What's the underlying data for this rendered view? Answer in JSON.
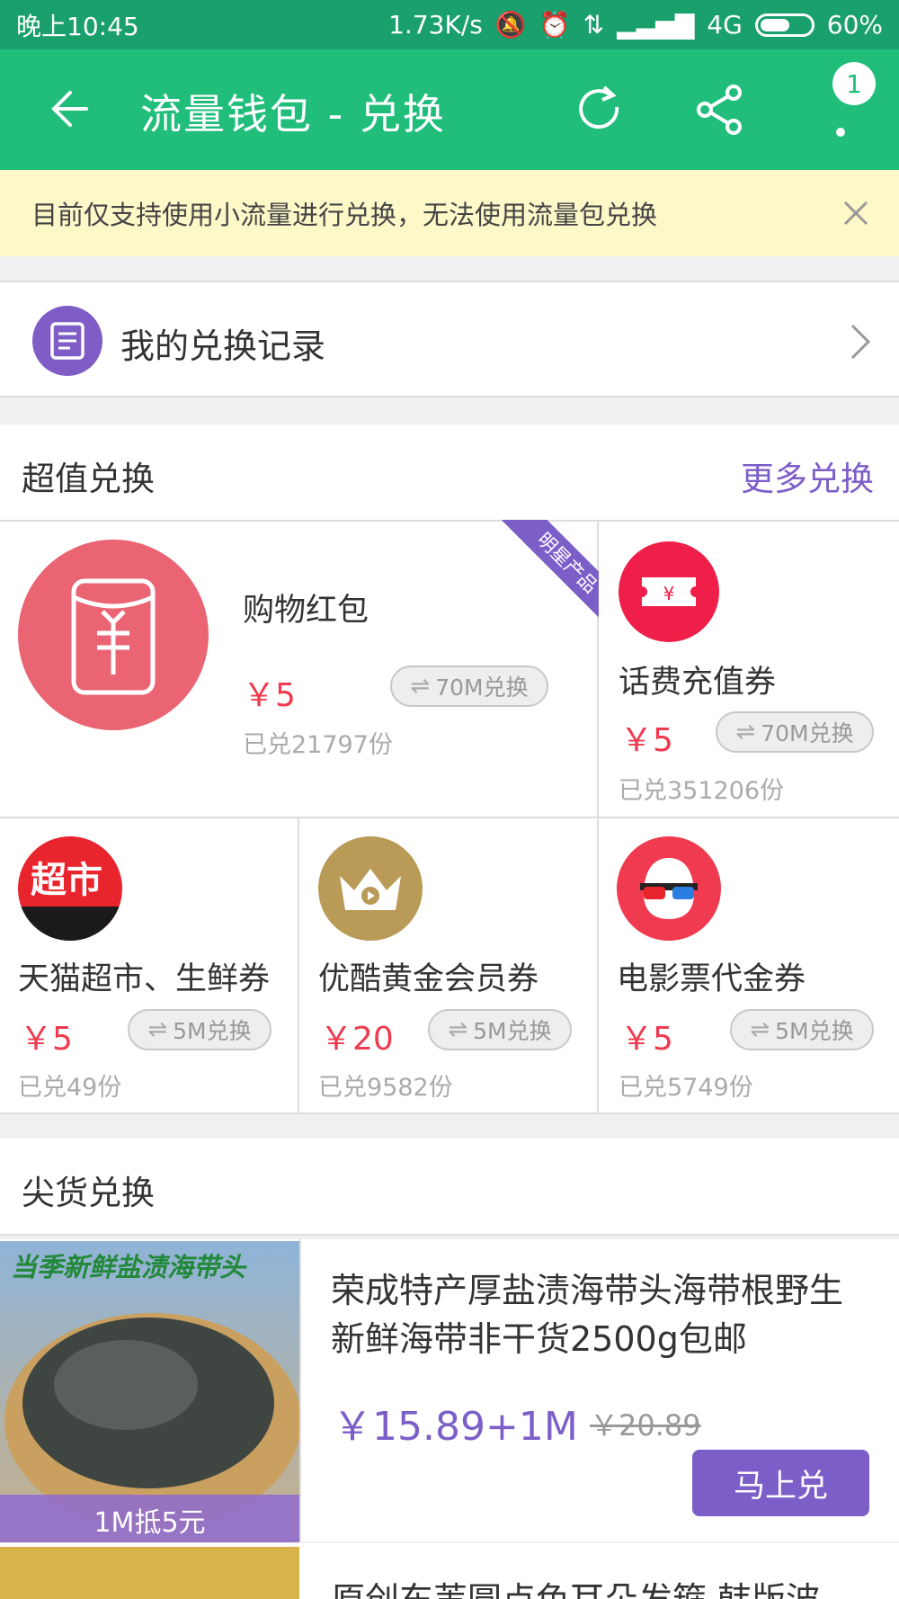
{
  "status": {
    "time": "晚上10:45",
    "speed": "1.73K/s",
    "network": "4G",
    "battery": "60%",
    "battery_level": 0.6
  },
  "appbar": {
    "title": "流量钱包 - 兑换",
    "badge": "1"
  },
  "notice": {
    "text": "目前仅支持使用小流量进行兑换，无法使用流量包兑换"
  },
  "records": {
    "label": "我的兑换记录"
  },
  "value_section": {
    "title": "超值兑换",
    "more": "更多兑换",
    "featured": {
      "name": "购物红包",
      "price": "￥5",
      "exchange": "70M兑换",
      "sold": "已兑21797份",
      "ribbon": "明星产品",
      "icon": "red-envelope-icon",
      "color": "#ea6474"
    },
    "items": [
      {
        "name": "话费充值券",
        "price": "￥5",
        "exchange": "70M兑换",
        "sold": "已兑351206份",
        "icon": "ticket-icon",
        "color": "#ef1f4a"
      },
      {
        "name": "天猫超市、生鲜券",
        "price": "￥5",
        "exchange": "5M兑换",
        "sold": "已兑49份",
        "icon": "tmall-supermarket-icon",
        "color": "#e8242d",
        "icon_text": "超市"
      },
      {
        "name": "优酷黄金会员券",
        "price": "￥20",
        "exchange": "5M兑换",
        "sold": "已兑9582份",
        "icon": "crown-icon",
        "color": "#b99a56"
      },
      {
        "name": "电影票代金券",
        "price": "￥5",
        "exchange": "5M兑换",
        "sold": "已兑5749份",
        "icon": "movie-glasses-icon",
        "color": "#ef3a4f"
      }
    ]
  },
  "hot_section": {
    "title": "尖货兑换",
    "products": [
      {
        "title": "荣成特产厚盐渍海带头海带根野生新鲜海带非干货2500g包邮",
        "price": "￥15.89+1M",
        "old_price": "￥20.89",
        "image_banner": "当季新鲜盐渍海带头",
        "image_tag": "1M抵5元",
        "button": "马上兑"
      },
      {
        "title": "原创东苇圆点色耳朵发箍 韩版波"
      }
    ]
  }
}
